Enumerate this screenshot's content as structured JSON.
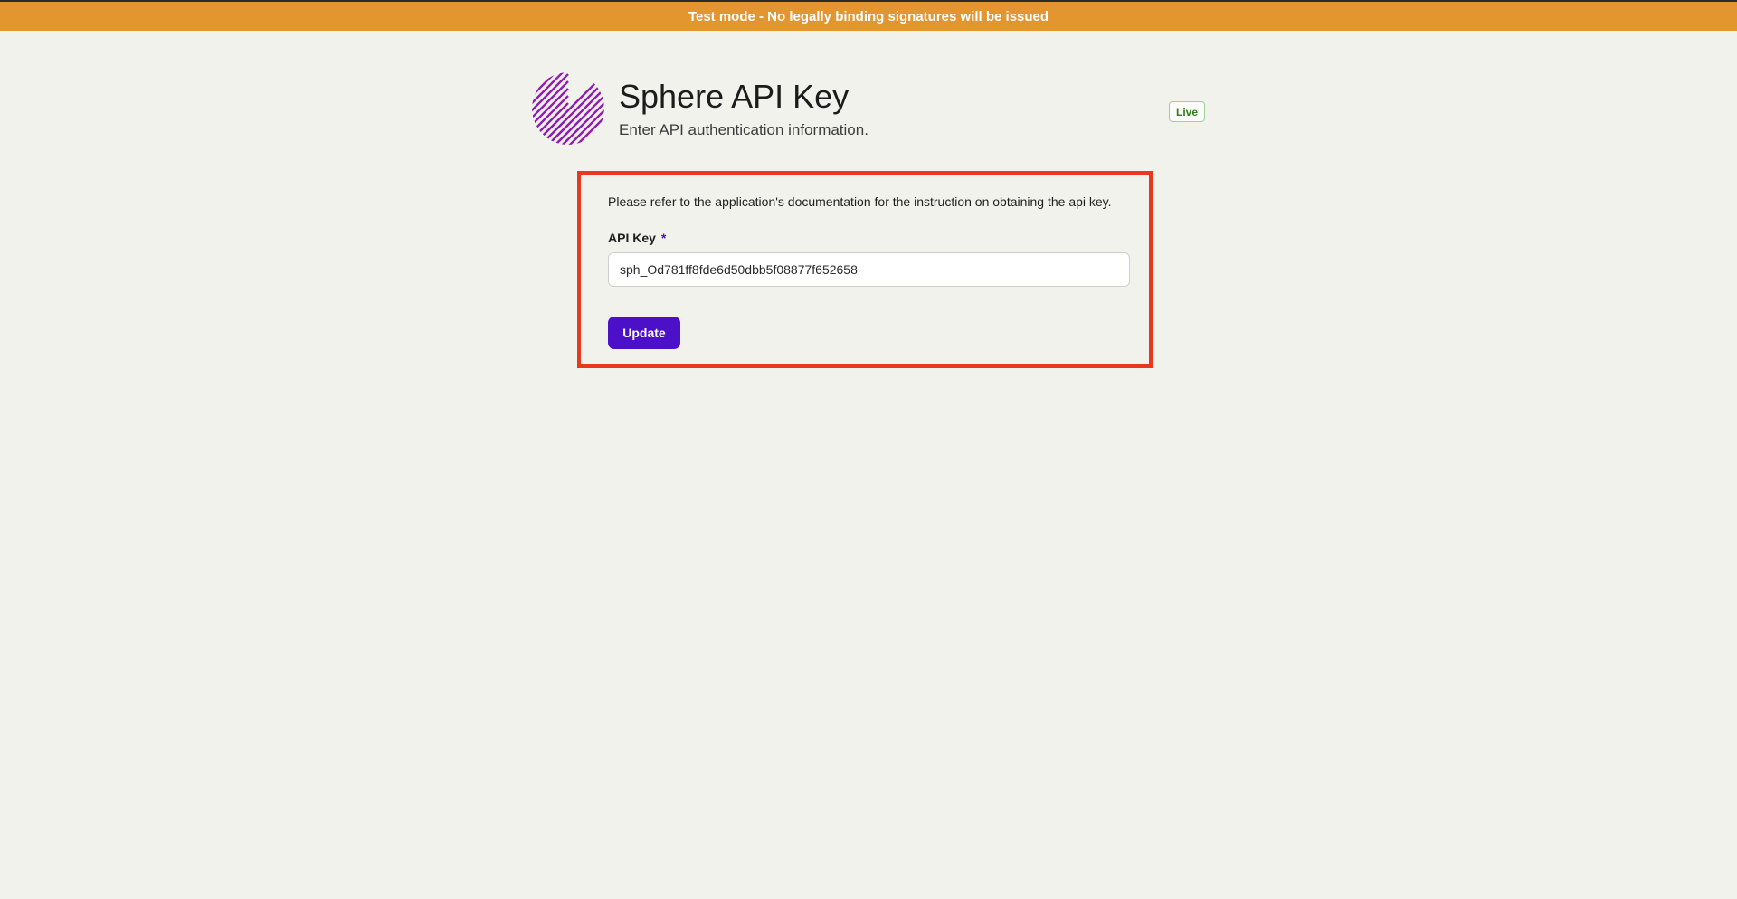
{
  "banner": {
    "text": "Test mode - No legally binding signatures will be issued",
    "color": "#e3952f"
  },
  "header": {
    "logo_icon": "striped-sphere-logo-icon",
    "title": "Sphere API Key",
    "subtitle": "Enter API authentication information.",
    "badge": "Live"
  },
  "form": {
    "instruction": "Please refer to the application's documentation for the instruction on obtaining the api key.",
    "api_key_label": "API Key",
    "required_marker": "*",
    "api_key_value": "sph_Od781ff8fde6d50dbb5f08877f652658",
    "update_label": "Update"
  },
  "colors": {
    "primary": "#4b10c8",
    "highlight_border": "#e9381f",
    "live_badge_text": "#2f7d1f"
  }
}
